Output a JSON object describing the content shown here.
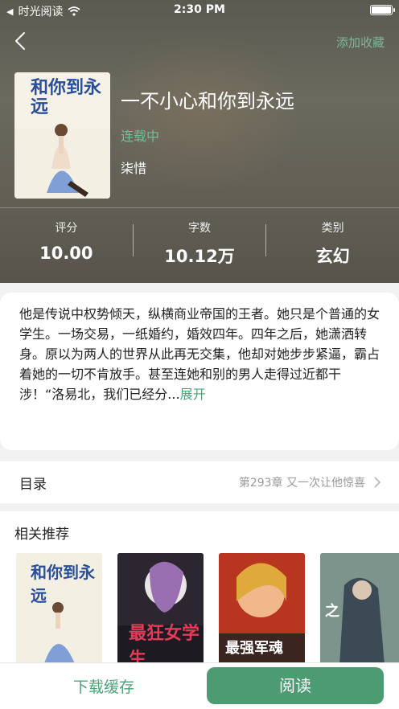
{
  "status_bar": {
    "carrier": "时光阅读",
    "time": "2:30 PM"
  },
  "header": {
    "favorite_label": "添加收藏"
  },
  "book": {
    "title": "一不小心和你到永远",
    "status": "连载中",
    "author": "柒惜",
    "cover_text": "和你到永远"
  },
  "stats": [
    {
      "label": "评分",
      "value": "10.00"
    },
    {
      "label": "字数",
      "value": "10.12万"
    },
    {
      "label": "类别",
      "value": "玄幻"
    }
  ],
  "description": {
    "text": "他是传说中权势倾天，纵横商业帝国的王者。她只是个普通的女学生。一场交易，一纸婚约，婚效四年。四年之后，她潇洒转身。原以为两人的世界从此再无交集，他却对她步步紧逼，霸占着她的一切不肯放手。甚至连她和别的男人走得过近都干涉！“洛易北，我们已经分...",
    "more_label": "展开"
  },
  "toc": {
    "title": "目录",
    "latest": "第293章 又一次让他惊喜"
  },
  "recommend": {
    "title": "相关推荐",
    "books": [
      {
        "cover_text": "和你到永远"
      },
      {
        "cover_text": "最狂女学生"
      },
      {
        "cover_text": "最强军魂"
      },
      {
        "cover_text": "之"
      }
    ]
  },
  "bottom": {
    "download_label": "下载缓存",
    "read_label": "阅读"
  },
  "colors": {
    "accent": "#4d9b72",
    "accent_text": "#4fa178",
    "status_green": "#6fbf95"
  }
}
